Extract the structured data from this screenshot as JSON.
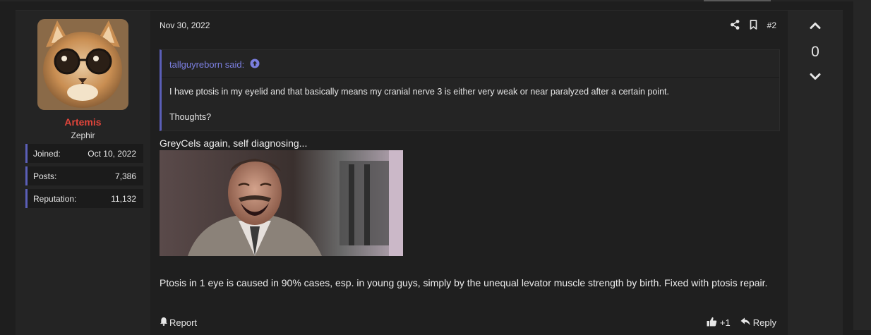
{
  "user": {
    "name": "Artemis",
    "title": "Zephir",
    "stats": [
      {
        "label": "Joined:",
        "value": "Oct 10, 2022"
      },
      {
        "label": "Posts:",
        "value": "7,386"
      },
      {
        "label": "Reputation:",
        "value": "11,132"
      }
    ],
    "name_color": "#e0453b"
  },
  "post": {
    "date": "Nov 30, 2022",
    "number": "#2",
    "quote": {
      "author": "tallguyreborn said:",
      "lines": [
        "I have ptosis in my eyelid and that basically means my cranial nerve 3 is either very weak or near paralyzed after a certain point.",
        "Thoughts?"
      ]
    },
    "body_intro": "GreyCels again, self diagnosing...",
    "body_text": "Ptosis in 1 eye is caused in 90% cases, esp. in young guys, simply by the unequal levator muscle strength by birth. Fixed with ptosis repair.",
    "footer": {
      "report": "Report",
      "like_count": "+1",
      "reply": "Reply"
    }
  },
  "vote": {
    "count": "0"
  },
  "icons": {
    "share": "share-icon",
    "bookmark": "bookmark-icon",
    "quote_arrow": "arrow-up-circle-icon",
    "report": "bell-icon",
    "like": "thumbs-up-icon",
    "reply": "reply-icon",
    "upvote": "chevron-up-icon",
    "downvote": "chevron-down-icon"
  },
  "colors": {
    "accent": "#5b5fb8",
    "link": "#7b7fe0",
    "background": "#1e1e1e"
  }
}
